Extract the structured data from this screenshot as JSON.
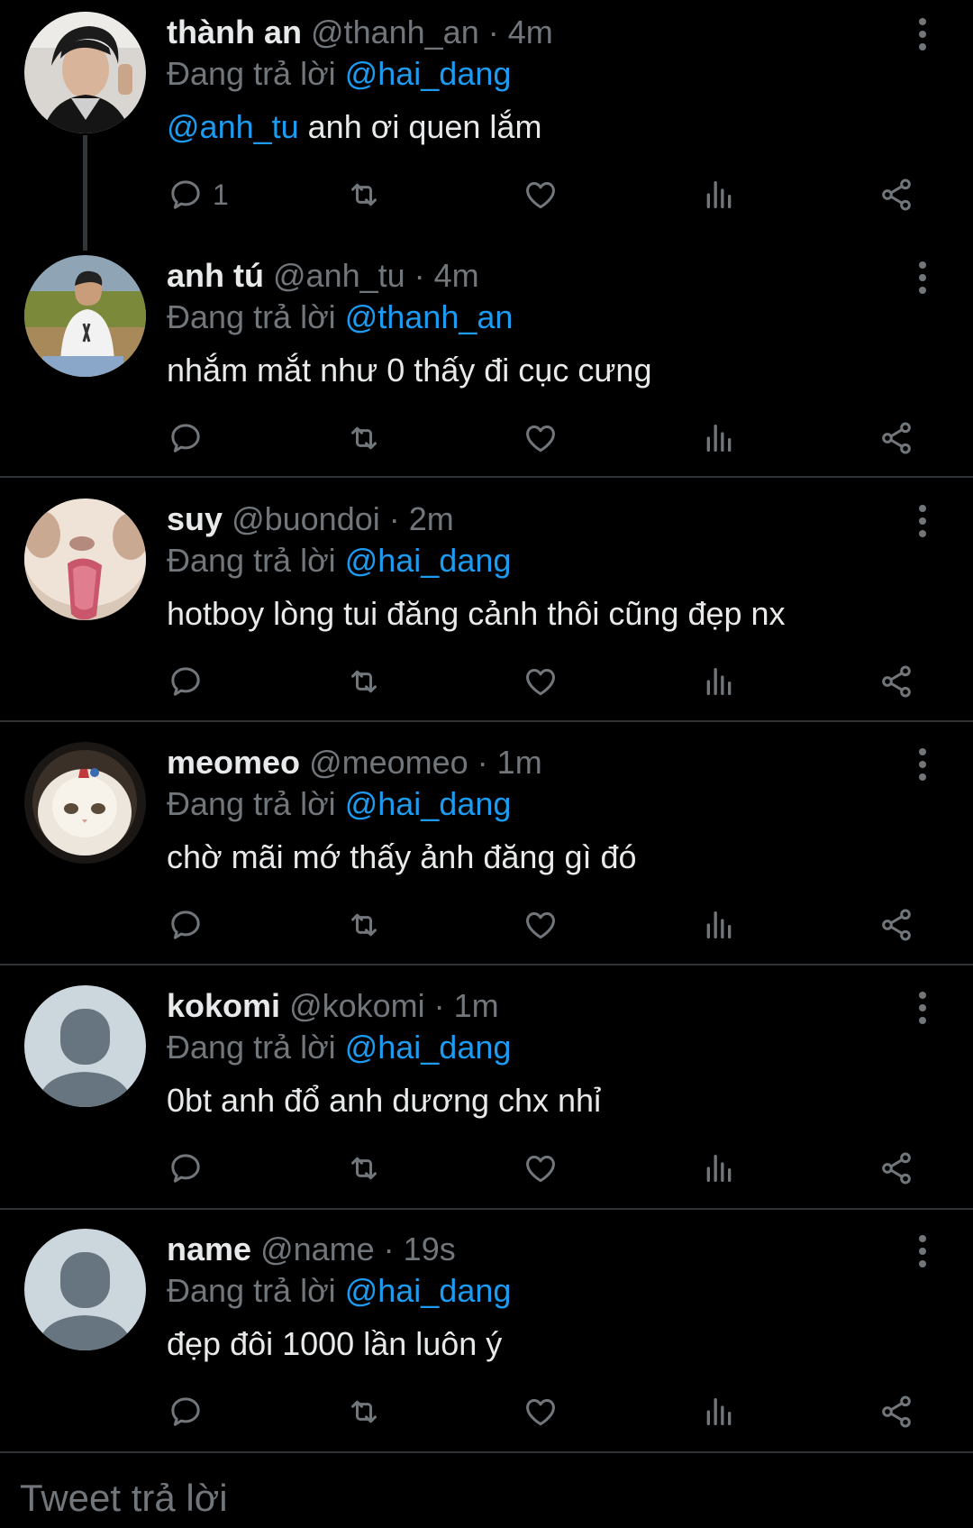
{
  "reply_prefix": "Đang trả lời",
  "tweets": [
    {
      "name": "thành an",
      "handle": "@thanh_an",
      "time": "4m",
      "reply_to": "@hai_dang",
      "mention": "@anh_tu",
      "text": " anh ơi quen lắm",
      "reply_count": "1",
      "avatar": "photo-man-dark"
    },
    {
      "name": "anh tú",
      "handle": "@anh_tu",
      "time": "4m",
      "reply_to": "@thanh_an",
      "mention": "",
      "text": "nhắm mắt như 0 thấy đi cục cưng",
      "reply_count": "",
      "avatar": "photo-man-outdoor"
    },
    {
      "name": "suy",
      "handle": "@buondoi",
      "time": "2m",
      "reply_to": "@hai_dang",
      "mention": "",
      "text": "hotboy lòng tui đăng cảnh thôi cũng đẹp nx",
      "reply_count": "",
      "avatar": "photo-cat-tongue"
    },
    {
      "name": "meomeo",
      "handle": "@meomeo",
      "time": "1m",
      "reply_to": "@hai_dang",
      "mention": "",
      "text": "chờ mãi mớ thấy ảnh đăng gì đó",
      "reply_count": "",
      "avatar": "photo-fluffy-kitten"
    },
    {
      "name": "kokomi",
      "handle": "@kokomi",
      "time": "1m",
      "reply_to": "@hai_dang",
      "mention": "",
      "text": "0bt anh đổ anh dương chx nhỉ",
      "reply_count": "",
      "avatar": "default-avatar"
    },
    {
      "name": "name",
      "handle": "@name",
      "time": "19s",
      "reply_to": "@hai_dang",
      "mention": "",
      "text": "đẹp đôi 1000 lần luôn ý",
      "reply_count": "",
      "avatar": "default-avatar"
    }
  ],
  "composer_placeholder": "Tweet trả lời",
  "icons": {
    "reply": "reply-icon",
    "retweet": "retweet-icon",
    "like": "like-icon",
    "views": "views-icon",
    "share": "share-icon",
    "more": "more-options-icon"
  },
  "colors": {
    "background": "#000000",
    "text": "#e7e9ea",
    "muted": "#71767b",
    "accent": "#1d9bf0",
    "divider": "#2f3336"
  }
}
